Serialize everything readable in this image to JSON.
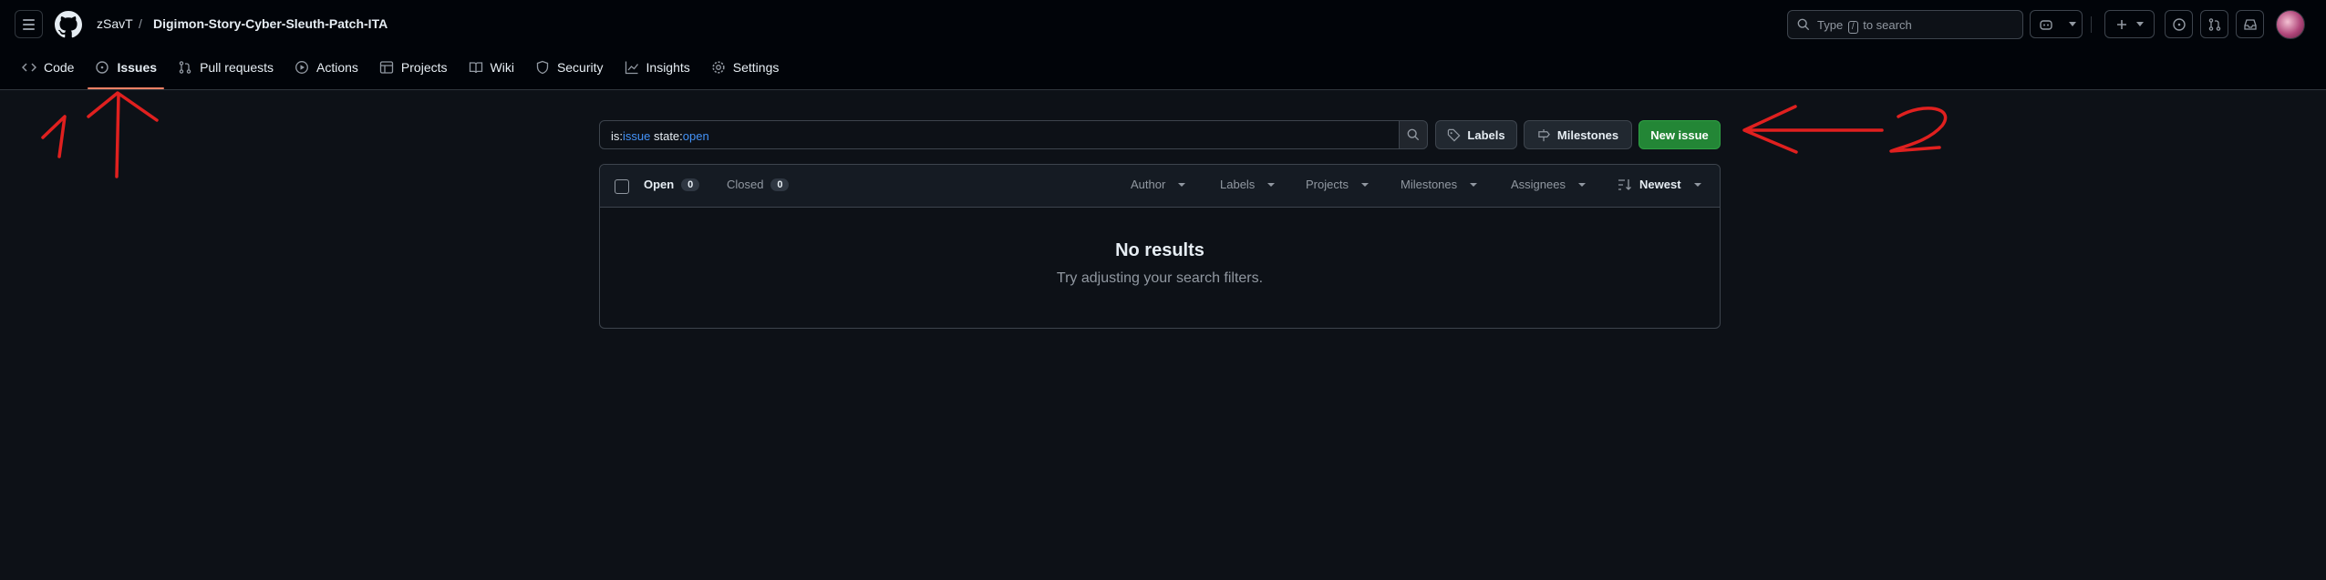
{
  "header": {
    "owner": "zSavT",
    "separator": "/",
    "repo": "Digimon-Story-Cyber-Sleuth-Patch-ITA",
    "search_prefix": "Type",
    "search_key": "/",
    "search_suffix": "to search"
  },
  "tabs": [
    {
      "label": "Code",
      "icon": "code-icon"
    },
    {
      "label": "Issues",
      "icon": "issue-opened-icon"
    },
    {
      "label": "Pull requests",
      "icon": "git-pull-request-icon"
    },
    {
      "label": "Actions",
      "icon": "play-icon"
    },
    {
      "label": "Projects",
      "icon": "table-icon"
    },
    {
      "label": "Wiki",
      "icon": "book-icon"
    },
    {
      "label": "Security",
      "icon": "shield-icon"
    },
    {
      "label": "Insights",
      "icon": "graph-icon"
    },
    {
      "label": "Settings",
      "icon": "gear-icon"
    }
  ],
  "filter": {
    "part1_key": "is:",
    "part1_val": "issue",
    "part2_key": " state:",
    "part2_val": "open",
    "labels_btn": "Labels",
    "milestones_btn": "Milestones",
    "new_issue_btn": "New issue"
  },
  "list": {
    "open_label": "Open",
    "open_count": "0",
    "closed_label": "Closed",
    "closed_count": "0",
    "filters": [
      "Author",
      "Labels",
      "Projects",
      "Milestones",
      "Assignees"
    ],
    "sort_label": "Newest",
    "empty_title": "No results",
    "empty_subtitle": "Try adjusting your search filters."
  },
  "colors": {
    "background": "#0d1117",
    "header_bg": "#010409",
    "accent_underline": "#f78166",
    "link_blue": "#4493f8",
    "primary_green": "#238636",
    "annotation_red": "#e0201f"
  }
}
